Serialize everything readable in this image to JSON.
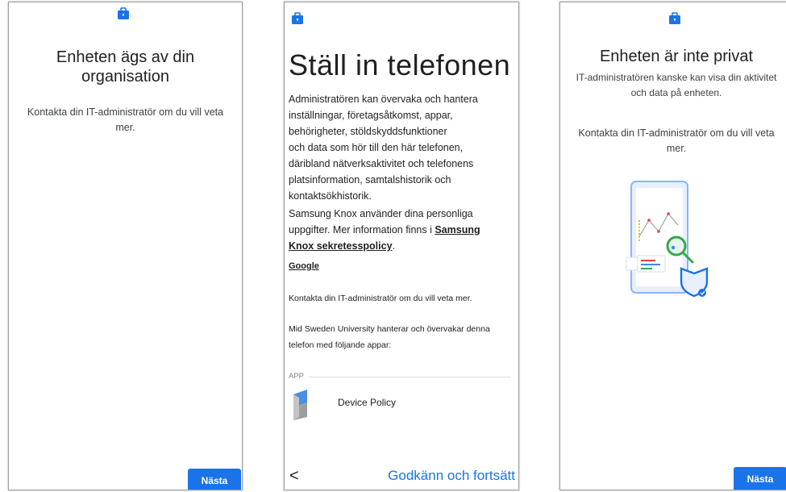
{
  "colors": {
    "accent": "#1a73e8",
    "icon_blue": "#1a73e8",
    "green": "#34a853",
    "red": "#ea4335",
    "yellow": "#fbbc04"
  },
  "screen1": {
    "icon": "briefcase-icon",
    "title_line1": "Enheten ägs av din",
    "title_line2": "organisation",
    "body_line1": "Kontakta din IT-administratör om du vill veta",
    "body_line2": "mer.",
    "next_label": "Nästa"
  },
  "screen2": {
    "icon": "briefcase-icon",
    "title": "Ställ in telefonen",
    "paragraph1_lines": [
      "Administratören kan övervaka och hantera",
      "inställningar, företagsåtkomst, appar,",
      "behörigheter, stöldskyddsfunktioner",
      "och data som hör till den här telefonen,",
      "däribland nätverksaktivitet och telefonens",
      "platsinformation, samtalshistorik och",
      "kontaktsökhistorik."
    ],
    "paragraph2_line1": "Samsung Knox använder dina personliga",
    "paragraph2_line2_prefix": "uppgifter. Mer information finns i ",
    "paragraph2_link_part1": "Samsung",
    "paragraph2_link_part2": "Knox sekretesspolicy",
    "paragraph2_suffix": ".",
    "google_link": "Google",
    "contact_text": "Kontakta din IT-administratör om du vill veta mer.",
    "manage_line1": "Mid Sweden University hanterar och övervakar denna",
    "manage_line2": "telefon med följande appar:",
    "app_section_label": "APP",
    "app_name": "Device Policy",
    "back_label": "<",
    "accept_label": "Godkänn och fortsätt"
  },
  "screen3": {
    "icon": "briefcase-icon",
    "title": "Enheten är inte privat",
    "body1_line1": "IT-administratören kanske kan visa din aktivitet",
    "body1_line2": "och data på enheten.",
    "body2_line1": "Kontakta din IT-administratör om du vill veta",
    "body2_line2": "mer.",
    "illustration": "phone-monitoring-illustration",
    "next_label": "Nästa"
  }
}
